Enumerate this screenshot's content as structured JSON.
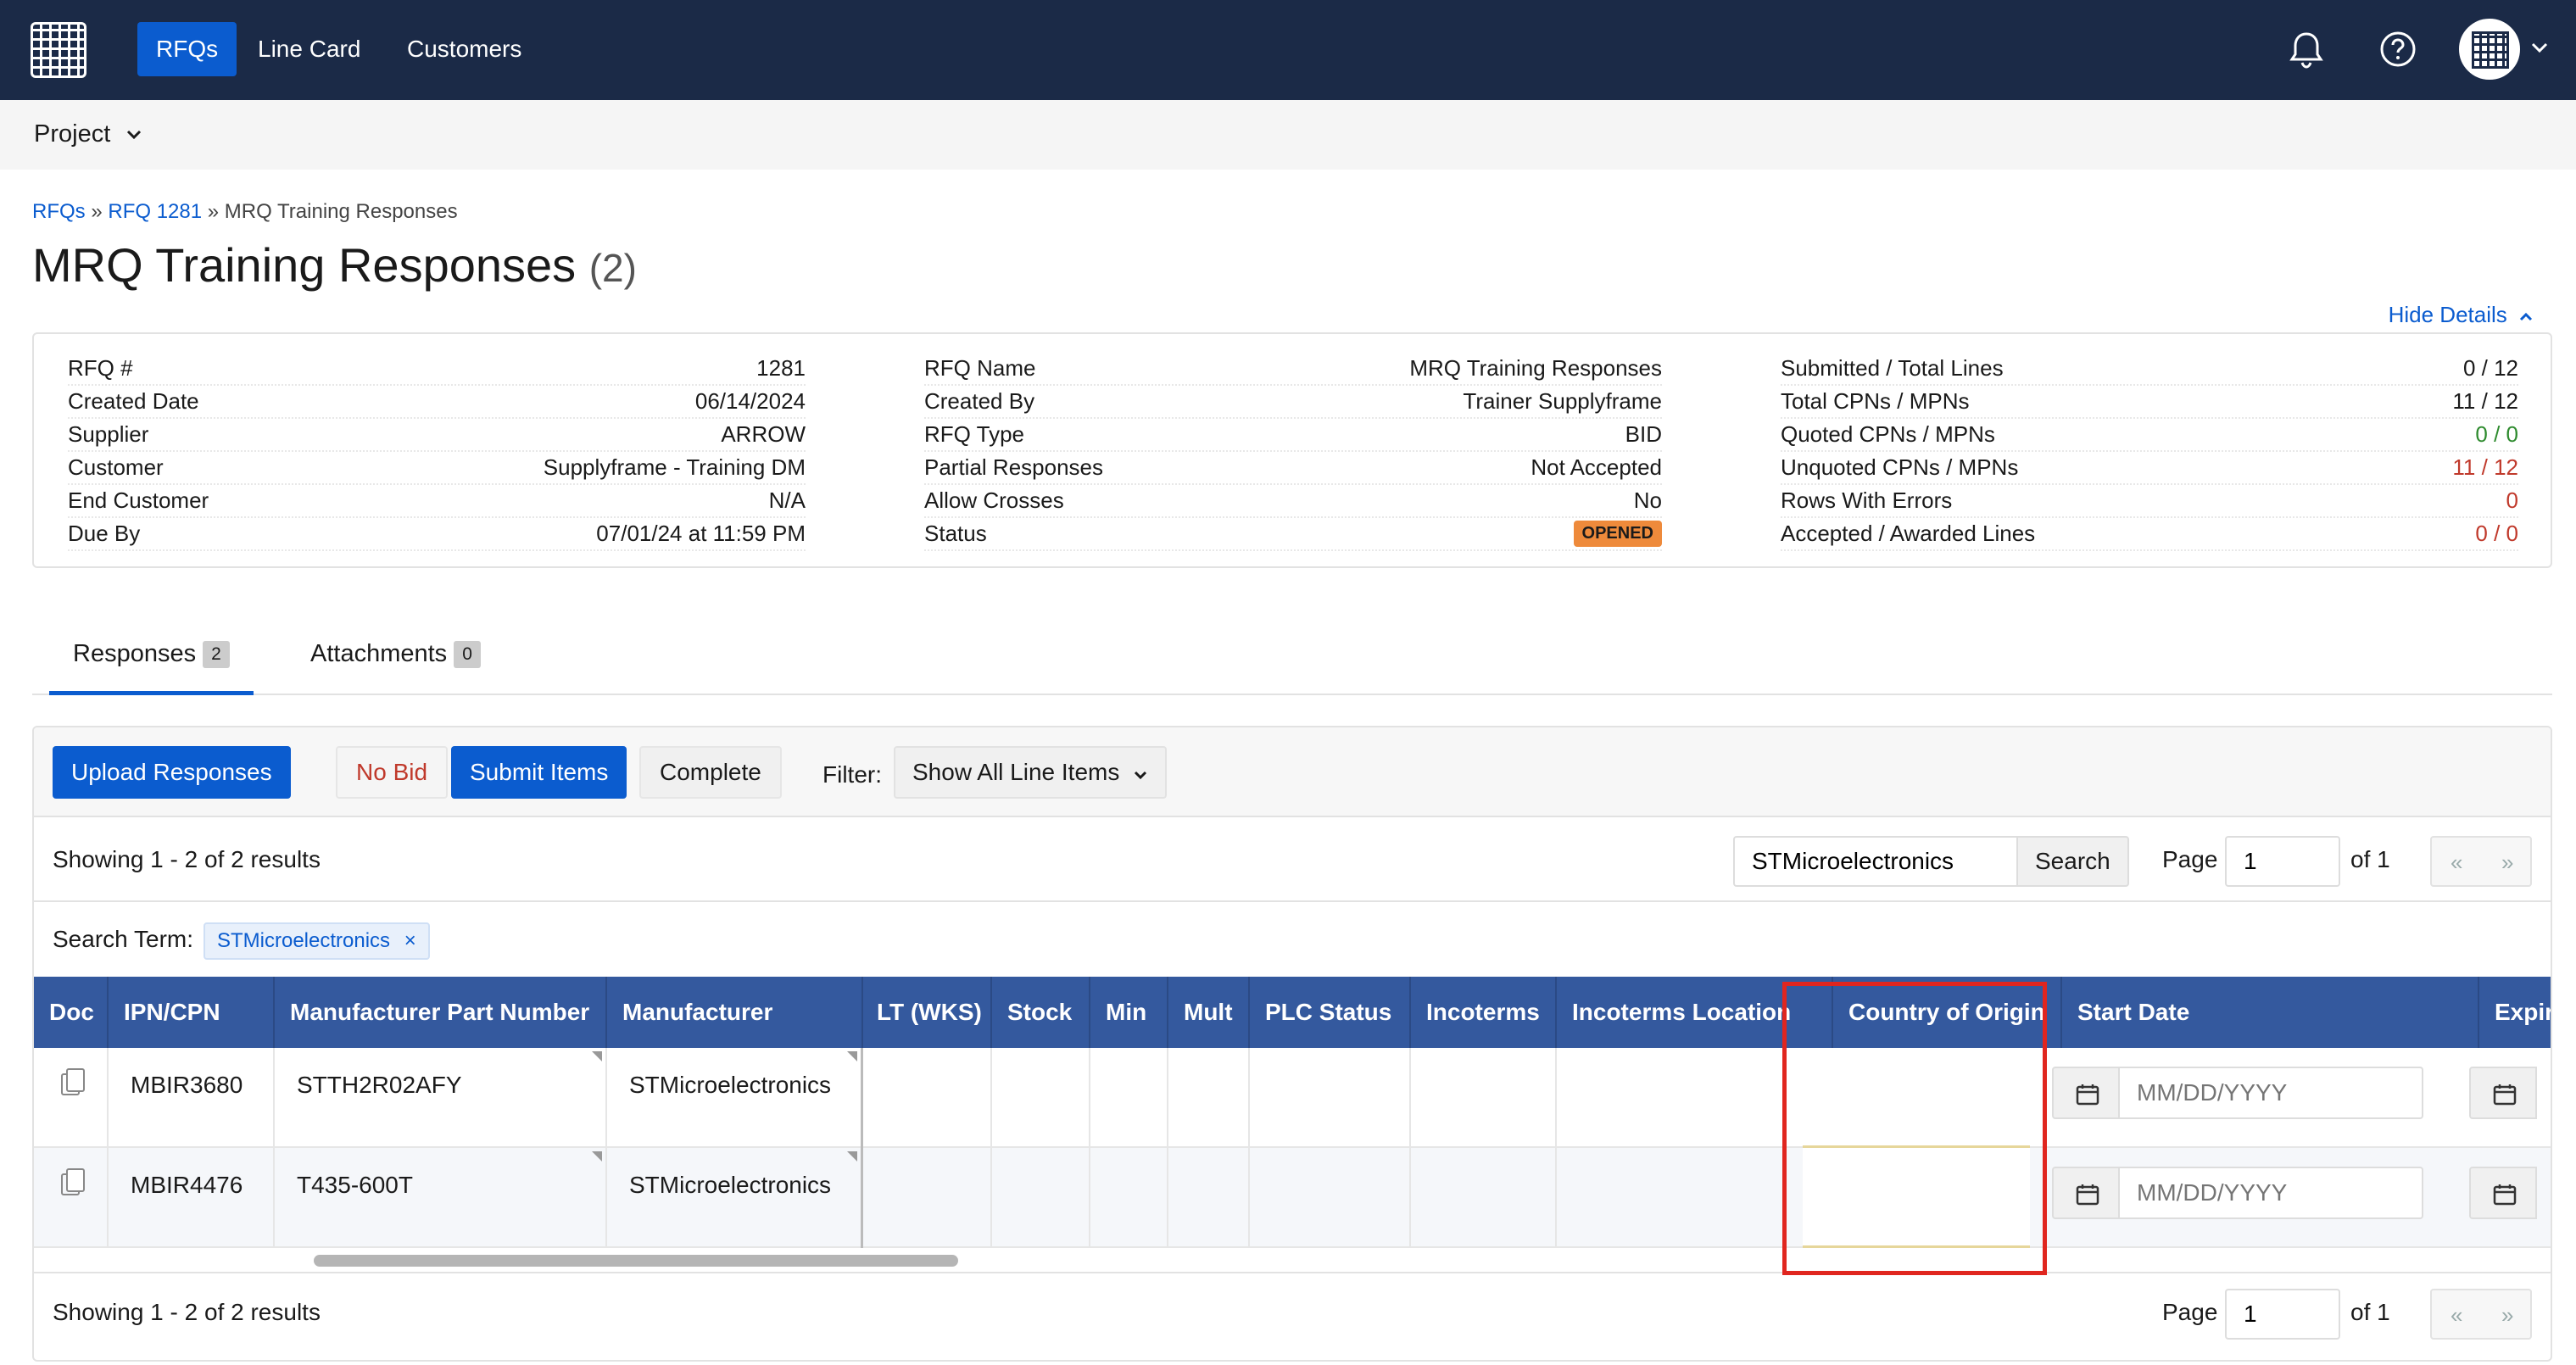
{
  "nav": {
    "tabs": [
      "RFQs",
      "Line Card",
      "Customers"
    ],
    "icons": [
      "grid-logo-icon",
      "bell-icon",
      "help-icon",
      "avatar-icon"
    ]
  },
  "subnav": {
    "project_label": "Project"
  },
  "breadcrumb": {
    "rfqs": "RFQs",
    "rfq": "RFQ 1281",
    "current": "MRQ Training Responses",
    "sep": "»"
  },
  "page": {
    "title": "MRQ Training Responses",
    "count": "(2)",
    "hide_details": "Hide Details"
  },
  "details": {
    "col1": [
      {
        "label": "RFQ #",
        "value": "1281"
      },
      {
        "label": "Created Date",
        "value": "06/14/2024"
      },
      {
        "label": "Supplier",
        "value": "ARROW"
      },
      {
        "label": "Customer",
        "value": "Supplyframe - Training DM"
      },
      {
        "label": "End Customer",
        "value": "N/A"
      },
      {
        "label": "Due By",
        "value": "07/01/24 at 11:59 PM"
      }
    ],
    "col2": [
      {
        "label": "RFQ Name",
        "value": "MRQ Training Responses"
      },
      {
        "label": "Created By",
        "value": "Trainer Supplyframe"
      },
      {
        "label": "RFQ Type",
        "value": "BID"
      },
      {
        "label": "Partial Responses",
        "value": "Not Accepted"
      },
      {
        "label": "Allow Crosses",
        "value": "No"
      },
      {
        "label": "Status",
        "value": "OPENED"
      }
    ],
    "col3": [
      {
        "label": "Submitted / Total Lines",
        "value": "0 / 12"
      },
      {
        "label": "Total CPNs / MPNs",
        "value": "11 / 12"
      },
      {
        "label": "Quoted CPNs / MPNs",
        "value": "0 / 0"
      },
      {
        "label": "Unquoted CPNs / MPNs",
        "value": "11 / 12"
      },
      {
        "label": "Rows With Errors",
        "value": "0"
      },
      {
        "label": "Accepted / Awarded Lines",
        "value": "0 / 0"
      }
    ]
  },
  "tabs": [
    {
      "label": "Responses",
      "count": "2"
    },
    {
      "label": "Attachments",
      "count": "0"
    }
  ],
  "toolbar": {
    "upload": "Upload Responses",
    "no_bid": "No Bid",
    "submit": "Submit Items",
    "complete": "Complete",
    "filter_label": "Filter:",
    "filter_value": "Show All Line Items"
  },
  "results": {
    "showing": "Showing 1 - 2 of 2 results",
    "search_value": "STMicroelectronics",
    "search_button": "Search",
    "page_label": "Page",
    "page_value": "1",
    "of_label": "of 1",
    "prev": "«",
    "next": "»"
  },
  "search_term": {
    "label": "Search Term:",
    "chip": "STMicroelectronics",
    "remove": "×"
  },
  "table": {
    "columns": [
      "Doc",
      "IPN/CPN",
      "Manufacturer Part Number",
      "Manufacturer",
      "LT (WKS)",
      "Stock",
      "Min",
      "Mult",
      "PLC Status",
      "Incoterms",
      "Incoterms Location",
      "Country of Origin",
      "Start Date",
      "Expire D"
    ],
    "rows": [
      {
        "ipn": "MBIR3680",
        "mpn": "STTH2R02AFY",
        "mfr": "STMicroelectronics",
        "start_placeholder": "MM/DD/YYYY"
      },
      {
        "ipn": "MBIR4476",
        "mpn": "T435-600T",
        "mfr": "STMicroelectronics",
        "start_placeholder": "MM/DD/YYYY"
      }
    ]
  },
  "colors": {
    "nav_bg": "#1b2a47",
    "accent": "#0b5ccf",
    "header_bg": "#34599e",
    "highlight": "#e0261f",
    "opened_badge": "#ee8a3b"
  }
}
